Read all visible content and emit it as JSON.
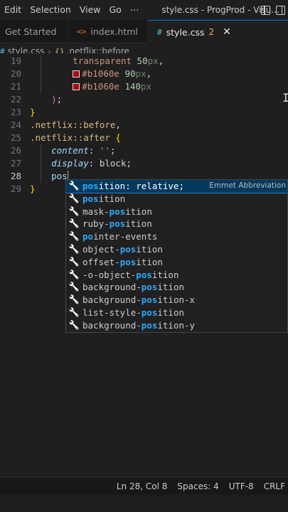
{
  "window": {
    "title": "style.css - ProgProd - Visu...",
    "menu": [
      "Edit",
      "Selection",
      "View",
      "Go",
      "⋯"
    ]
  },
  "tabs": [
    {
      "label": "Get Started",
      "icon": "vscode-welcome-icon"
    },
    {
      "label": "index.html",
      "icon": "<>",
      "icon_name": "html-file-icon"
    },
    {
      "label": "style.css",
      "icon": "#",
      "icon_name": "css-file-icon",
      "badge": "2",
      "active": true
    }
  ],
  "breadcrumb": {
    "file": "style.css",
    "file_icon": "#",
    "symbol": ".netflix::before"
  },
  "editor": {
    "lines": [
      {
        "n": "19",
        "indent": 4,
        "parts": [
          [
            "c-val",
            "transparent "
          ],
          [
            "c-num",
            "50"
          ],
          [
            "c-unit",
            "px"
          ],
          [
            "c-punc",
            ","
          ]
        ]
      },
      {
        "n": "20",
        "indent": 4,
        "swatch": true,
        "parts": [
          [
            "c-val",
            "#b1060e "
          ],
          [
            "c-num",
            "90"
          ],
          [
            "c-unit",
            "px"
          ],
          [
            "c-punc",
            ","
          ]
        ]
      },
      {
        "n": "21",
        "indent": 4,
        "swatch": true,
        "parts": [
          [
            "c-val",
            "#b1060e "
          ],
          [
            "c-num",
            "140"
          ],
          [
            "c-unit",
            "px"
          ]
        ]
      },
      {
        "n": "22",
        "indent": 2,
        "parts": [
          [
            "c-paren",
            ")"
          ],
          [
            "c-punc",
            ";"
          ]
        ]
      },
      {
        "n": "23",
        "indent": 0,
        "parts": [
          [
            "c-brace",
            "}"
          ]
        ]
      },
      {
        "n": "24",
        "indent": 0,
        "parts": [
          [
            "c-sel",
            ".netflix::before"
          ],
          [
            "c-punc",
            ","
          ]
        ]
      },
      {
        "n": "25",
        "indent": 0,
        "parts": [
          [
            "c-sel",
            ".netflix::after "
          ],
          [
            "c-brace",
            "{"
          ]
        ]
      },
      {
        "n": "26",
        "indent": 2,
        "parts": [
          [
            "c-prop",
            "content"
          ],
          [
            "c-punc",
            ": "
          ],
          [
            "c-val",
            "''"
          ],
          [
            "c-punc",
            ";"
          ]
        ]
      },
      {
        "n": "27",
        "indent": 2,
        "parts": [
          [
            "c-prop",
            "display"
          ],
          [
            "c-punc",
            ": "
          ],
          [
            "c-kw",
            "block"
          ],
          [
            "c-punc",
            ";"
          ]
        ]
      },
      {
        "n": "28",
        "indent": 2,
        "active": true,
        "parts": [
          [
            "c-typing",
            "pos"
          ]
        ]
      },
      {
        "n": "29",
        "indent": 0,
        "parts": [
          [
            "c-brace",
            "}"
          ]
        ]
      }
    ]
  },
  "suggest": {
    "typed": "pos",
    "items": [
      {
        "pre": "",
        "match": "pos",
        "post": "ition: relative;",
        "detail": "Emmet Abbreviation",
        "selected": true
      },
      {
        "pre": "",
        "match": "pos",
        "post": "ition"
      },
      {
        "pre": "mask-",
        "match": "pos",
        "post": "ition"
      },
      {
        "pre": "ruby-",
        "match": "pos",
        "post": "ition"
      },
      {
        "pre": "",
        "match": "po",
        "post": "inter-events"
      },
      {
        "pre": "object-",
        "match": "pos",
        "post": "ition"
      },
      {
        "pre": "offset-",
        "match": "pos",
        "post": "ition"
      },
      {
        "pre": "-o-object-",
        "match": "pos",
        "post": "ition"
      },
      {
        "pre": "background-",
        "match": "pos",
        "post": "ition"
      },
      {
        "pre": "background-",
        "match": "pos",
        "post": "ition-x"
      },
      {
        "pre": "list-style-",
        "match": "pos",
        "post": "ition"
      },
      {
        "pre": "background-",
        "match": "pos",
        "post": "ition-y"
      }
    ]
  },
  "status": {
    "position": "Ln 28, Col 8",
    "spaces": "Spaces: 4",
    "encoding": "UTF-8",
    "eol": "CRLF"
  },
  "colors": {
    "accent": "#0078d4",
    "swatch": "#b1060e",
    "match_highlight": "#2aaaff",
    "selected_row": "#04395e"
  }
}
